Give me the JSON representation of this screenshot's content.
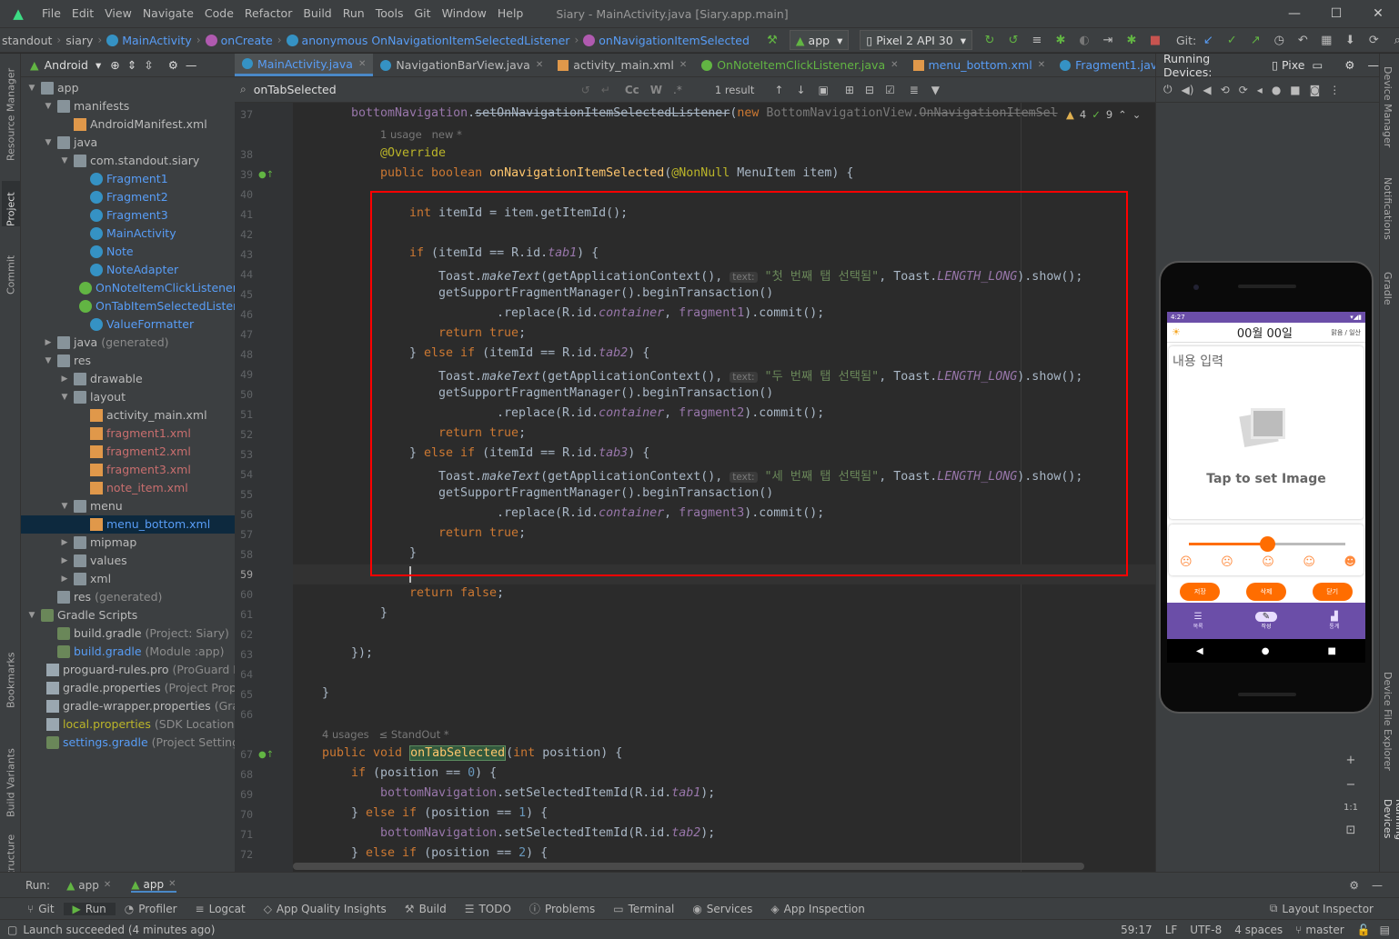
{
  "window": {
    "title": "Siary - MainActivity.java [Siary.app.main]",
    "menu": [
      "File",
      "Edit",
      "View",
      "Navigate",
      "Code",
      "Refactor",
      "Build",
      "Run",
      "Tools",
      "Git",
      "Window",
      "Help"
    ]
  },
  "breadcrumbs": [
    "standout",
    "siary",
    "MainActivity",
    "onCreate",
    "anonymous OnNavigationItemSelectedListener",
    "onNavigationItemSelected"
  ],
  "toolbar": {
    "run_config": "app",
    "device": "Pixel 2 API 30",
    "git_label": "Git:"
  },
  "project": {
    "view": "Android",
    "tree": [
      {
        "label": "app",
        "depth": 0,
        "kind": "folder",
        "open": true,
        "color": "default"
      },
      {
        "label": "manifests",
        "depth": 1,
        "kind": "folder",
        "open": true
      },
      {
        "label": "AndroidManifest.xml",
        "depth": 2,
        "kind": "xml"
      },
      {
        "label": "java",
        "depth": 1,
        "kind": "folder",
        "open": true
      },
      {
        "label": "com.standout.siary",
        "depth": 2,
        "kind": "folder",
        "open": true
      },
      {
        "label": "Fragment1",
        "depth": 3,
        "kind": "class",
        "color": "blue"
      },
      {
        "label": "Fragment2",
        "depth": 3,
        "kind": "class",
        "color": "blue"
      },
      {
        "label": "Fragment3",
        "depth": 3,
        "kind": "class",
        "color": "blue"
      },
      {
        "label": "MainActivity",
        "depth": 3,
        "kind": "class",
        "color": "blue"
      },
      {
        "label": "Note",
        "depth": 3,
        "kind": "class",
        "color": "blue"
      },
      {
        "label": "NoteAdapter",
        "depth": 3,
        "kind": "class",
        "color": "blue"
      },
      {
        "label": "OnNoteItemClickListener",
        "depth": 3,
        "kind": "interface",
        "color": "blue"
      },
      {
        "label": "OnTabItemSelectedListene",
        "depth": 3,
        "kind": "interface",
        "color": "blue"
      },
      {
        "label": "ValueFormatter",
        "depth": 3,
        "kind": "class",
        "color": "blue"
      },
      {
        "label": "java",
        "extra": "(generated)",
        "depth": 1,
        "kind": "folder",
        "closed": true
      },
      {
        "label": "res",
        "depth": 1,
        "kind": "folder",
        "open": true
      },
      {
        "label": "drawable",
        "depth": 2,
        "kind": "folder",
        "closed": true
      },
      {
        "label": "layout",
        "depth": 2,
        "kind": "folder",
        "open": true
      },
      {
        "label": "activity_main.xml",
        "depth": 3,
        "kind": "xml"
      },
      {
        "label": "fragment1.xml",
        "depth": 3,
        "kind": "xml",
        "color": "red"
      },
      {
        "label": "fragment2.xml",
        "depth": 3,
        "kind": "xml",
        "color": "red"
      },
      {
        "label": "fragment3.xml",
        "depth": 3,
        "kind": "xml",
        "color": "red"
      },
      {
        "label": "note_item.xml",
        "depth": 3,
        "kind": "xml",
        "color": "red"
      },
      {
        "label": "menu",
        "depth": 2,
        "kind": "folder",
        "open": true
      },
      {
        "label": "menu_bottom.xml",
        "depth": 3,
        "kind": "xml",
        "color": "blue",
        "selected": true
      },
      {
        "label": "mipmap",
        "depth": 2,
        "kind": "folder",
        "closed": true
      },
      {
        "label": "values",
        "depth": 2,
        "kind": "folder",
        "closed": true
      },
      {
        "label": "xml",
        "depth": 2,
        "kind": "folder",
        "closed": true
      },
      {
        "label": "res",
        "extra": "(generated)",
        "depth": 1,
        "kind": "folder"
      },
      {
        "label": "Gradle Scripts",
        "depth": 0,
        "kind": "gradle",
        "open": true
      },
      {
        "label": "build.gradle",
        "extra": "(Project: Siary)",
        "depth": 1,
        "kind": "gradle"
      },
      {
        "label": "build.gradle",
        "extra": "(Module :app)",
        "depth": 1,
        "kind": "gradle",
        "color": "blue"
      },
      {
        "label": "proguard-rules.pro",
        "extra": "(ProGuard Ru",
        "depth": 1,
        "kind": "file"
      },
      {
        "label": "gradle.properties",
        "extra": "(Project Proper",
        "depth": 1,
        "kind": "file"
      },
      {
        "label": "gradle-wrapper.properties",
        "extra": "(Gradl",
        "depth": 1,
        "kind": "file"
      },
      {
        "label": "local.properties",
        "extra": "(SDK Location)",
        "depth": 1,
        "kind": "file",
        "color": "yellow"
      },
      {
        "label": "settings.gradle",
        "extra": "(Project Settings)",
        "depth": 1,
        "kind": "gradle",
        "color": "blue"
      }
    ]
  },
  "left_strip": [
    "Resource Manager",
    "Project",
    "Commit",
    "Bookmarks",
    "Build Variants",
    "Structure"
  ],
  "right_strip": [
    "Device Manager",
    "Notifications",
    "Gradle",
    "Device File Explorer",
    "Running Devices"
  ],
  "tabs": [
    {
      "label": "MainActivity.java",
      "kind": "class",
      "active": true
    },
    {
      "label": "NavigationBarView.java",
      "kind": "class"
    },
    {
      "label": "activity_main.xml",
      "kind": "xml"
    },
    {
      "label": "OnNoteItemClickListener.java",
      "kind": "interface"
    },
    {
      "label": "menu_bottom.xml",
      "kind": "xml"
    },
    {
      "label": "Fragment1.java",
      "kind": "class"
    }
  ],
  "search": {
    "query": "onTabSelected",
    "result": "1 result",
    "opts": [
      "Cc",
      "W",
      ".*"
    ]
  },
  "editor": {
    "warnings": "4",
    "weak": "9",
    "lines": [
      37,
      38,
      39,
      40,
      41,
      42,
      43,
      44,
      45,
      46,
      47,
      48,
      49,
      50,
      51,
      52,
      53,
      54,
      55,
      56,
      57,
      58,
      59,
      60,
      61,
      62,
      63,
      64,
      65,
      66,
      67,
      68,
      69,
      70,
      71,
      72
    ],
    "hint_usage1": "1 usage   new *",
    "hint_usage2": "4 usages   ≤ StandOut *",
    "t_override": "@Override",
    "t_itemid": "int itemId = item.getItemId();",
    "str1": "\"첫 번째 탭 선택됨\"",
    "str2": "\"두 번째 탭 선택됨\"",
    "str3": "\"세 번째 탭 선택됨\"",
    "param_hint": "text:"
  },
  "running_devices": {
    "label": "Running Devices:",
    "device": "Pixe"
  },
  "phone": {
    "status_time": "4:27",
    "date": "00월 00일",
    "weather": "맑음 / 일산",
    "content_hint": "내용 입력",
    "image_hint": "Tap to set Image",
    "buttons": [
      "저장",
      "삭제",
      "닫기"
    ],
    "nav": [
      "목록",
      "작성",
      "통계"
    ],
    "mood_level": 0.5
  },
  "zoom_ratio": "1:1",
  "runbar": {
    "label": "Run:",
    "tabs": [
      "app",
      "app"
    ]
  },
  "toolwindows": [
    "Git",
    "Run",
    "Profiler",
    "Logcat",
    "App Quality Insights",
    "Build",
    "TODO",
    "Problems",
    "Terminal",
    "Services",
    "App Inspection"
  ],
  "layout_inspector": "Layout Inspector",
  "status": {
    "message": "Launch succeeded (4 minutes ago)",
    "pos": "59:17",
    "eol": "LF",
    "enc": "UTF-8",
    "indent": "4 spaces",
    "branch": "master"
  },
  "colors": {
    "accent": "#4a88c7",
    "keyword": "#cc7832",
    "string": "#6a8759",
    "field": "#9876aa",
    "red_box": "#ff0000",
    "phone_purple": "#6b4ea8",
    "phone_orange": "#ff6d00"
  }
}
